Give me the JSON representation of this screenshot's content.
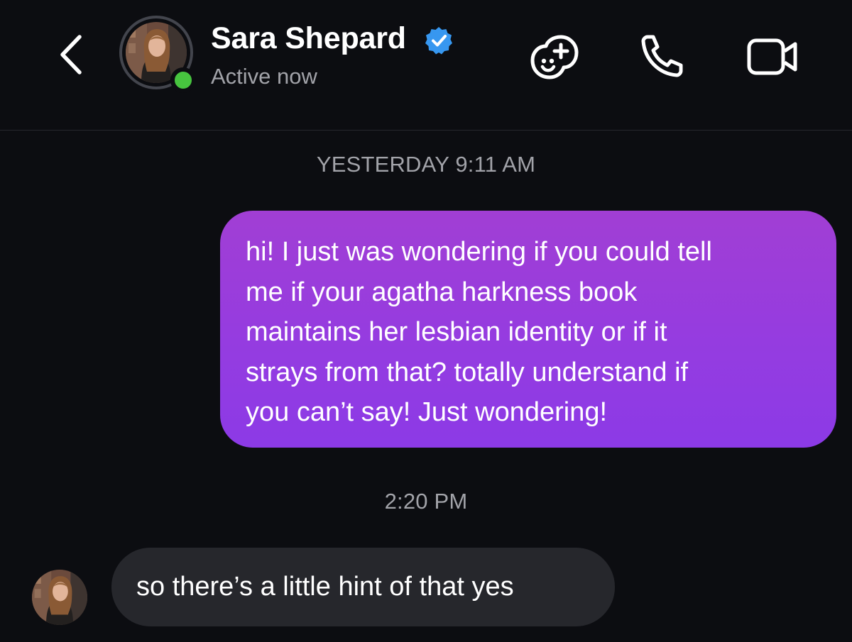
{
  "header": {
    "contact_name": "Sara Shepard",
    "status": "Active now",
    "verified": true,
    "icons": {
      "back": "chevron-left-icon",
      "verified": "verified-badge-icon",
      "games": "games-icon",
      "call": "phone-icon",
      "video": "video-camera-icon"
    }
  },
  "conversation": {
    "timestamp_1": "YESTERDAY 9:11 AM",
    "outgoing_message": {
      "lines": [
        "hi! I just was wondering if you could tell",
        "me if your agatha harkness book",
        "maintains her lesbian identity or if it",
        "strays from that? totally understand if",
        "you can’t say! Just wondering!"
      ]
    },
    "timestamp_2": "2:20 PM",
    "incoming_message": {
      "text": "so there’s a little hint of that yes"
    }
  },
  "colors": {
    "background": "#0c0d11",
    "outgoing_bubble": "#9a3cdc",
    "incoming_bubble": "#26272c",
    "secondary_text": "#a2a3a9",
    "online_indicator": "#47c43f",
    "verified_badge": "#3797f0"
  }
}
